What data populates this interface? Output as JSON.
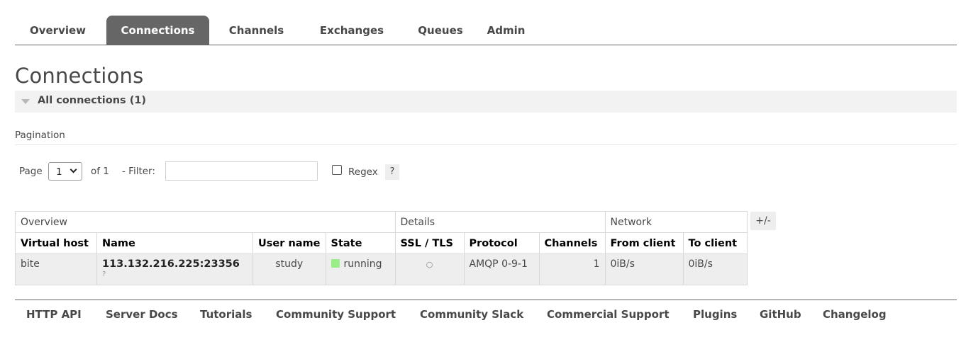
{
  "nav": {
    "tabs": [
      {
        "label": "Overview",
        "active": false
      },
      {
        "label": "Connections",
        "active": true
      },
      {
        "label": "Channels",
        "active": false
      },
      {
        "label": "Exchanges",
        "active": false
      },
      {
        "label": "Queues",
        "active": false
      },
      {
        "label": "Admin",
        "active": false
      }
    ]
  },
  "page": {
    "title": "Connections",
    "section_label": "All connections (1)"
  },
  "pagination": {
    "title": "Pagination",
    "page_label": "Page",
    "page_value": "1",
    "of_label": "of 1",
    "filter_label": "- Filter:",
    "filter_value": "",
    "regex_label": "Regex",
    "regex_checked": false,
    "help_label": "?"
  },
  "table": {
    "groups": [
      "Overview",
      "Details",
      "Network"
    ],
    "columns": [
      "Virtual host",
      "Name",
      "User name",
      "State",
      "SSL / TLS",
      "Protocol",
      "Channels",
      "From client",
      "To client"
    ],
    "toggle_label": "+/-",
    "rows": [
      {
        "vhost": "bite",
        "name": "113.132.216.225:23356",
        "name_sub": "?",
        "user": "study",
        "state": "running",
        "ssl": "○",
        "protocol": "AMQP 0-9-1",
        "channels": "1",
        "from_client": "0iB/s",
        "to_client": "0iB/s"
      }
    ]
  },
  "colors": {
    "tab_active_bg": "#666666",
    "state_running": "#99ee88",
    "row_bg": "#eeeeee"
  },
  "footer": {
    "links": [
      "HTTP API",
      "Server Docs",
      "Tutorials",
      "Community Support",
      "Community Slack",
      "Commercial Support",
      "Plugins",
      "GitHub",
      "Changelog"
    ]
  }
}
